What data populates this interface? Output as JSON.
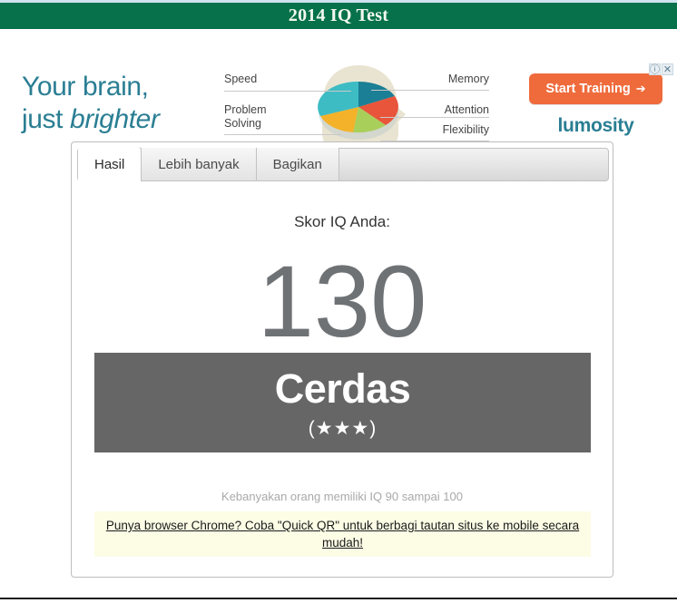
{
  "page": {
    "title": "2014 IQ Test",
    "accent_green": "#06714a",
    "accent_teal": "#2a7e93",
    "accent_orange": "#ef6b3c",
    "verdict_bg": "#666666"
  },
  "ad": {
    "slogan_line1": "Your brain,",
    "slogan_line2_plain": "just ",
    "slogan_line2_italic": "brighter",
    "brand": "lumosity",
    "cta_label": "Start Training",
    "cta_arrow": "➔",
    "adchoices_info_icon": "ⓘ",
    "adchoices_close_icon": "✕",
    "diagram_labels": {
      "speed": "Speed",
      "problem_solving_line1": "Problem",
      "problem_solving_line2": "Solving",
      "memory": "Memory",
      "attention": "Attention",
      "flexibility": "Flexibility"
    },
    "pie_colors": {
      "memory": "#1b7f96",
      "speed": "#3dbcc4",
      "attention": "#e8553a",
      "flexibility": "#a9cf5b",
      "problem_solving": "#f3b229",
      "head_silhouette": "#e8e3cf"
    }
  },
  "card": {
    "tabs": [
      {
        "label": "Hasil",
        "active": true
      },
      {
        "label": "Lebih banyak",
        "active": false
      },
      {
        "label": "Bagikan",
        "active": false
      }
    ],
    "score_label": "Skor IQ Anda:",
    "score_value": "130",
    "verdict_title": "Cerdas",
    "verdict_stars": "(★★★)",
    "average_note": "Kebanyakan orang memiliki IQ 90 sampai 100",
    "notice_link": "Punya browser Chrome? Coba \"Quick QR\" untuk berbagi tautan situs ke mobile secara mudah!"
  }
}
